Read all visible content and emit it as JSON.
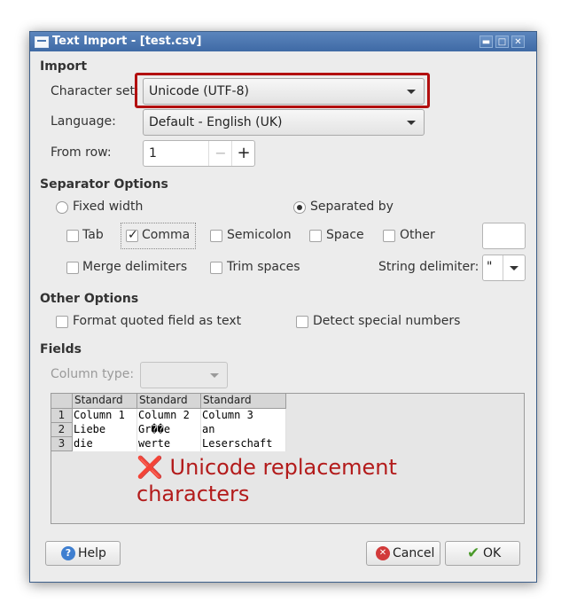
{
  "window": {
    "title": "Text Import - [test.csv]",
    "controls": {
      "minimize": "▬",
      "maximize": "□",
      "close": "✕"
    }
  },
  "import": {
    "section_label": "Import",
    "charset_label": "Character set:",
    "charset_value": "Unicode (UTF-8)",
    "language_label": "Language:",
    "language_value": "Default - English (UK)",
    "from_row_label": "From row:",
    "from_row_value": "1",
    "minus": "−",
    "plus": "+"
  },
  "separator": {
    "section_label": "Separator Options",
    "fixed_width": "Fixed width",
    "separated_by": "Separated by",
    "selected_mode": "separated_by",
    "tab": "Tab",
    "comma": "Comma",
    "semicolon": "Semicolon",
    "space": "Space",
    "other": "Other",
    "merge": "Merge delimiters",
    "trim": "Trim spaces",
    "string_delim_label": "String delimiter:",
    "string_delim_value": "\"",
    "checked": [
      "comma"
    ]
  },
  "other_options": {
    "section_label": "Other Options",
    "format_quoted": "Format quoted field as text",
    "detect_special": "Detect special numbers"
  },
  "fields": {
    "section_label": "Fields",
    "column_type_label": "Column type:",
    "headers": [
      "Standard",
      "Standard",
      "Standard"
    ],
    "rows": [
      {
        "num": "1",
        "cells": [
          "Column 1",
          "Column 2",
          "Column 3"
        ]
      },
      {
        "num": "2",
        "cells": [
          "Liebe",
          "Gr��e",
          "an"
        ]
      },
      {
        "num": "3",
        "cells": [
          "die",
          "werte",
          "Leserschaft"
        ]
      }
    ]
  },
  "annotation": {
    "icon": "❌",
    "line1": "Unicode replacement",
    "line2": "characters",
    "color": "#b31b1b"
  },
  "buttons": {
    "help": "Help",
    "cancel": "Cancel",
    "ok": "OK",
    "help_icon": "?",
    "cancel_icon": "✕",
    "ok_icon": "✔"
  },
  "colors": {
    "titlebar": "#4a76b0",
    "highlight": "#b20f0f",
    "dialog_bg": "#ececec"
  }
}
